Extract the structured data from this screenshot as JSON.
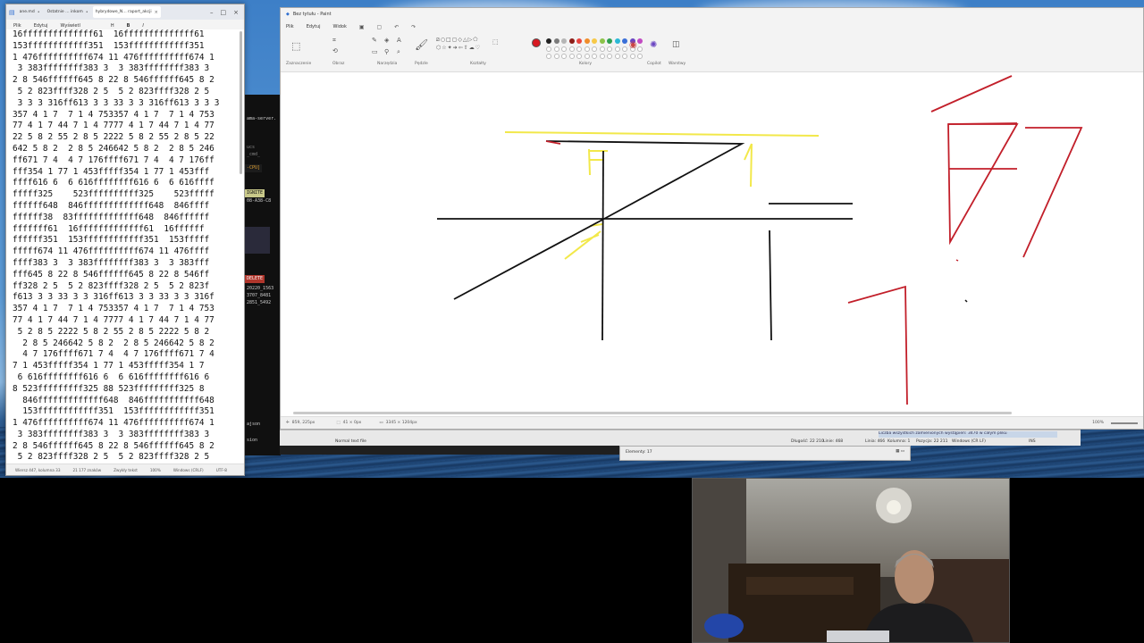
{
  "notepad": {
    "tabs": [
      {
        "label": "ane.md"
      },
      {
        "label": "Ostatnie … inkom"
      },
      {
        "label": "hybrydowe_N… raport_akcji"
      }
    ],
    "menu": [
      "Plik",
      "Edytuj",
      "Wyświetl"
    ],
    "menu_icons": [
      "H",
      "B",
      "I"
    ],
    "lines": [
      "16ffffffffffffff61  16ffffffffffffff61",
      "153ffffffffffff351  153ffffffffffff351",
      "1 476ffffffffff674 11 476ffffffffff674 1",
      " 3 383ffffffff383 3  3 383ffffffff383 3",
      "2 8 546ffffff645 8 22 8 546ffffff645 8 2",
      " 5 2 823ffff328 2 5  5 2 823ffff328 2 5",
      " 3 3 3 316ff613 3 3 33 3 3 316ff613 3 3 3",
      "357 4 1 7  7 1 4 753357 4 1 7  7 1 4 753",
      "77 4 1 7 44 7 1 4 7777 4 1 7 44 7 1 4 77",
      "22 5 8 2 55 2 8 5 2222 5 8 2 55 2 8 5 22",
      "642 5 8 2  2 8 5 246642 5 8 2  2 8 5 246",
      "ff671 7 4  4 7 176ffff671 7 4  4 7 176ff",
      "fff354 1 77 1 453fffff354 1 77 1 453fff",
      "ffff616 6  6 616ffffffff616 6  6 616ffff",
      "fffff325    523ffffffffff325    523fffff",
      "ffffff648  846fffffffffffff648  846ffff",
      "ffffff38  83fffffffffffff648  846ffffff",
      "fffffff61  16fffffffffffff61  16ffffff",
      "ffffff351  153ffffffffffff351  153fffff",
      "fffff674 11 476ffffffffff674 11 476ffff",
      "ffff383 3  3 383ffffffff383 3  3 383fff",
      "fff645 8 22 8 546ffffff645 8 22 8 546ff",
      "ff328 2 5  5 2 823ffff328 2 5  5 2 823f",
      "f613 3 3 33 3 3 316ff613 3 3 33 3 3 316f",
      "357 4 1 7  7 1 4 753357 4 1 7  7 1 4 753",
      "77 4 1 7 44 7 1 4 7777 4 1 7 44 7 1 4 77",
      " 5 2 8 5 2222 5 8 2 55 2 8 5 2222 5 8 2",
      "  2 8 5 246642 5 8 2  2 8 5 246642 5 8 2",
      "  4 7 176ffff671 7 4  4 7 176ffff671 7 4",
      "7 1 453fffff354 1 77 1 453fffff354 1 7",
      " 6 616ffffffff616 6  6 616ffffffff616 6",
      "8 523fffffffff325 88 523fffffffff325 8",
      "  846fffffffffffff648  846fffffffffff648",
      "  153ffffffffffff351  153ffffffffffff351",
      "1 476ffffffffff674 11 476ffffffffff674 1",
      " 3 383ffffffff383 3  3 383ffffffff383 3",
      "2 8 546ffffff645 8 22 8 546ffffff645 8 2",
      " 5 2 823ffff328 2 5  5 2 823ffff328 2 5",
      "3 3 3 316ff613 3 3 33 3 3 316ff613 3 3 3"
    ],
    "status": [
      "Wiersz 447, kolumna 33",
      "21 177 znaków",
      "Zwykły tekst",
      "100%",
      "Windows (CRLF)",
      "UTF-8"
    ]
  },
  "terminal": {
    "lines": [
      "ama-server.",
      "ucs",
      "",
      "_cmd_",
      "08-A38-C8",
      "20220_1563",
      "3707_8481",
      "2851_5492",
      "ajson",
      "sion"
    ],
    "tags": [
      "-CPU]",
      "IGNITE",
      "DELETE"
    ]
  },
  "paint": {
    "title": "Bez tytułu - Paint",
    "menu": [
      "Plik",
      "Edytuj",
      "Widok"
    ],
    "groups": [
      "Zaznaczenie",
      "Obraz",
      "Narzędzia",
      "Pędzle",
      "Kształty",
      "Kolory",
      "Copilot",
      "Warstwy"
    ],
    "colors": [
      "#d71921",
      "#222222",
      "#7a7a7a",
      "#b5b5b5",
      "#8c1d18",
      "#e8433f",
      "#f08c2a",
      "#f7c948",
      "#8bc34a",
      "#2e9e4f",
      "#2bb8d6",
      "#3a6fd8",
      "#6a45c2",
      "#c24ac2"
    ],
    "status": {
      "cursor": "859, 225px",
      "selection": "41 × 0px",
      "size": "3345 × 1204px",
      "zoom": "100%"
    }
  },
  "editor_bar": {
    "mode": "Normal text file",
    "stats": [
      "Długość: 22 210",
      "Linie: 468",
      "Linia: 466",
      "Kolumna: 1",
      "Pozycja: 22 211",
      "Windows (CR LF)",
      "INS"
    ],
    "message": "Liczba wszystkich zamienionych wystąpień: 3470 w całym pliku"
  },
  "elements": {
    "label": "Elementy: 17"
  }
}
